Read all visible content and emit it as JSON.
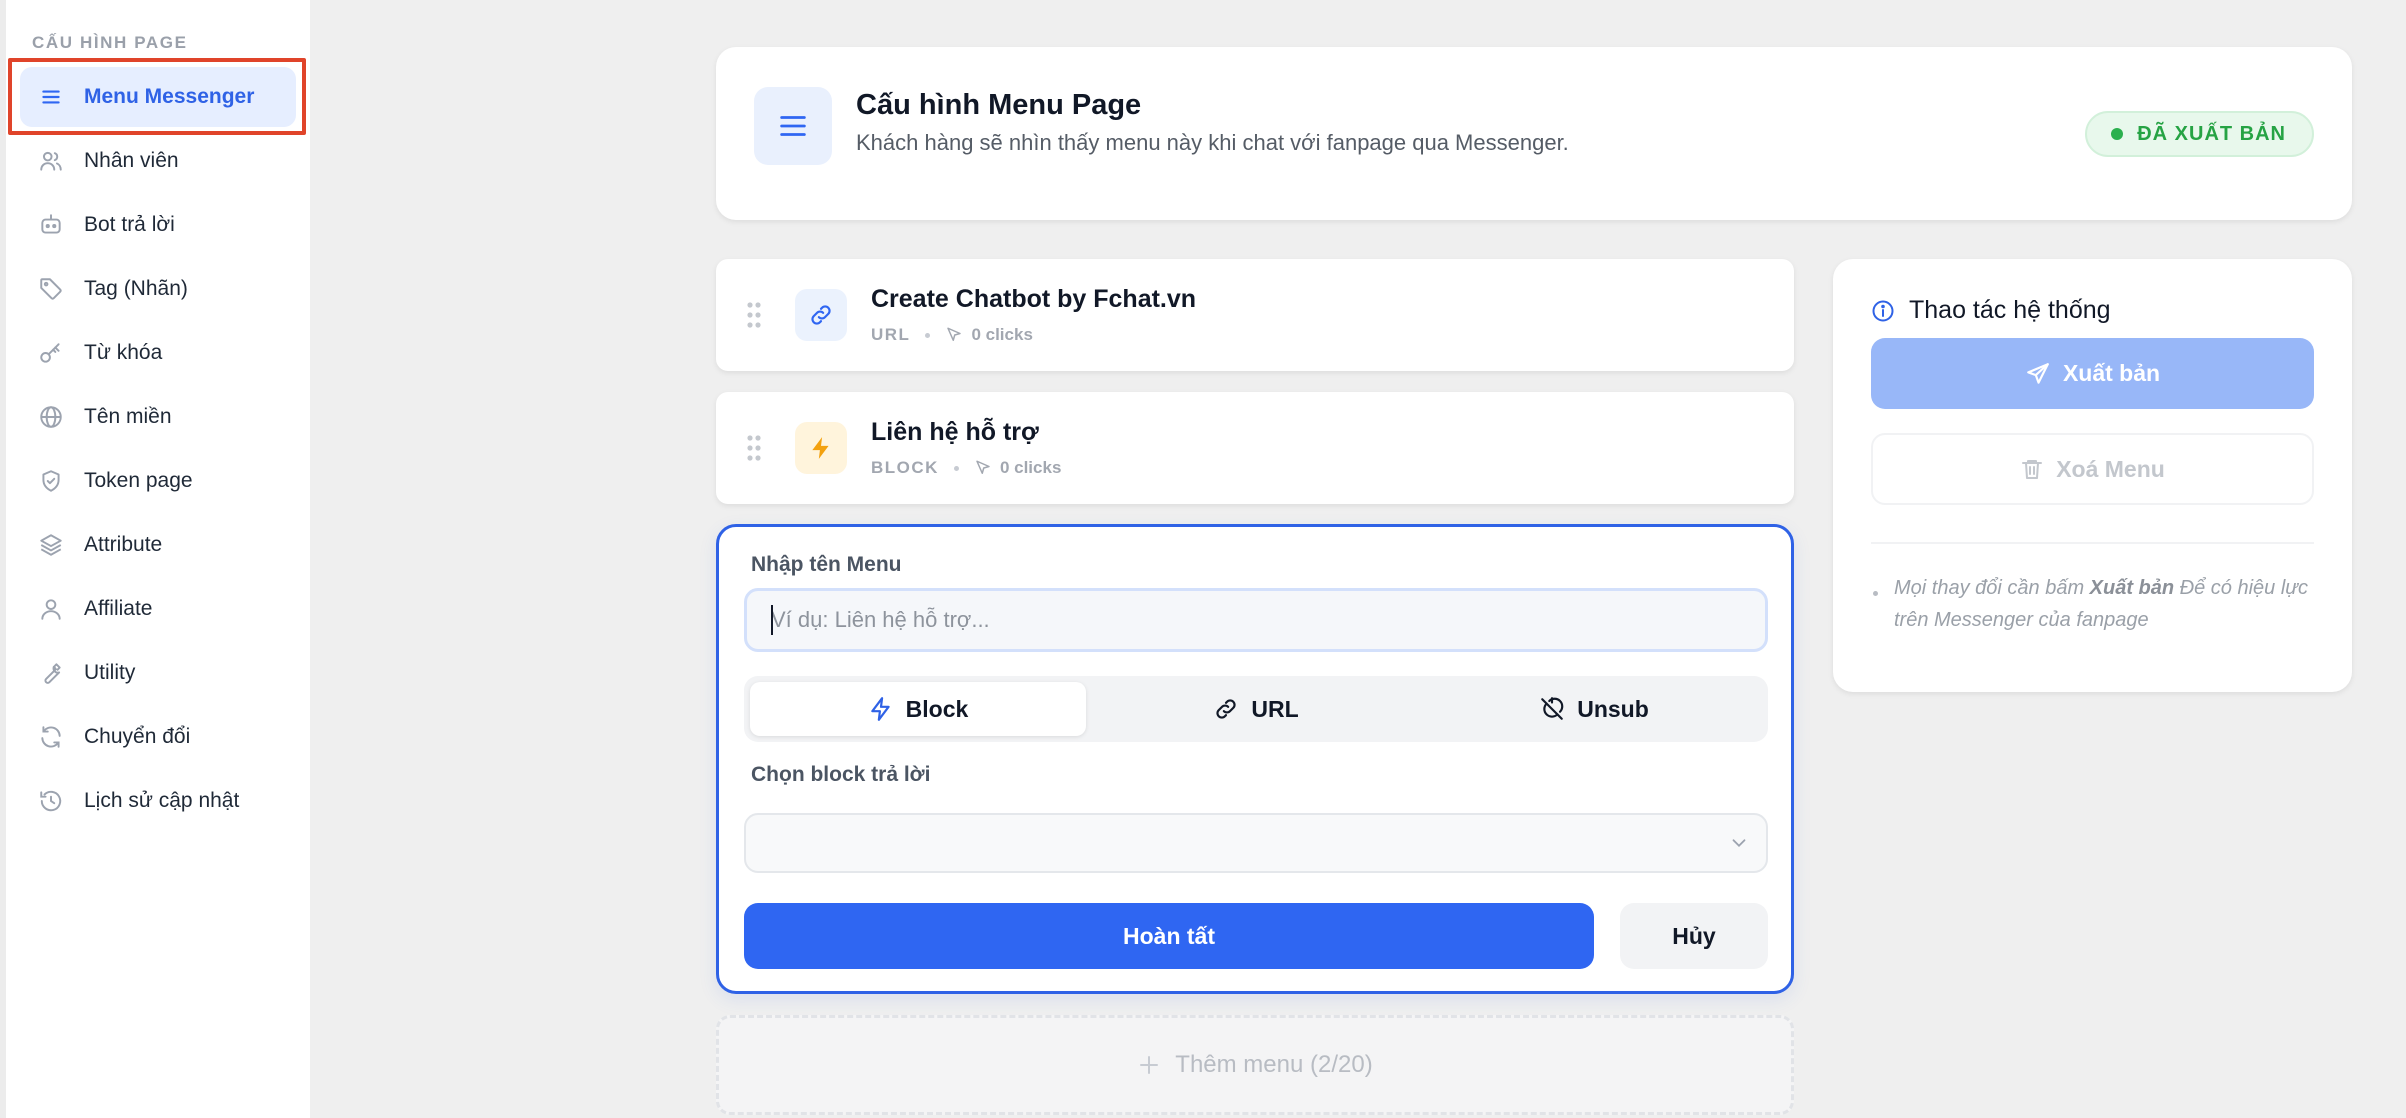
{
  "sidebar": {
    "section_title": "CẤU HÌNH PAGE",
    "items": [
      {
        "label": "Menu Messenger",
        "icon": "menu-icon",
        "active": true
      },
      {
        "label": "Nhân viên",
        "icon": "users-icon"
      },
      {
        "label": "Bot trả lời",
        "icon": "bot-icon"
      },
      {
        "label": "Tag (Nhãn)",
        "icon": "tag-icon"
      },
      {
        "label": "Từ khóa",
        "icon": "key-icon"
      },
      {
        "label": "Tên miền",
        "icon": "globe-icon"
      },
      {
        "label": "Token page",
        "icon": "shield-icon"
      },
      {
        "label": "Attribute",
        "icon": "layers-icon"
      },
      {
        "label": "Affiliate",
        "icon": "user-icon"
      },
      {
        "label": "Utility",
        "icon": "wrench-icon"
      },
      {
        "label": "Chuyển đổi",
        "icon": "refresh-icon"
      },
      {
        "label": "Lịch sử cập nhật",
        "icon": "history-icon"
      }
    ]
  },
  "header": {
    "icon": "menu-icon",
    "title": "Cấu hình Menu Page",
    "subtitle": "Khách hàng sẽ nhìn thấy menu này khi chat với fanpage qua Messenger.",
    "status": "ĐÃ XUẤT BẢN",
    "status_color": "#26a344"
  },
  "menu_items": [
    {
      "title": "Create Chatbot by Fchat.vn",
      "type": "URL",
      "clicks": "0 clicks",
      "icon": "link-icon"
    },
    {
      "title": "Liên hệ hỗ trợ",
      "type": "BLOCK",
      "clicks": "0 clicks",
      "icon": "lightning-icon"
    }
  ],
  "editor": {
    "name_label": "Nhập tên Menu",
    "name_value": "",
    "name_placeholder": "Ví dụ: Liên hệ hỗ trợ...",
    "types": [
      {
        "label": "Block",
        "icon": "lightning-icon",
        "active": true
      },
      {
        "label": "URL",
        "icon": "link-icon"
      },
      {
        "label": "Unsub",
        "icon": "unsubscribe-icon"
      }
    ],
    "block_label": "Chọn block trả lời",
    "block_value": "",
    "submit_label": "Hoàn tất",
    "cancel_label": "Hủy",
    "accent_color": "#2f66f2"
  },
  "add_menu": {
    "label": "Thêm menu (2/20)"
  },
  "side_panel": {
    "title": "Thao tác hệ thống",
    "publish_label": "Xuất bản",
    "delete_label": "Xoá Menu",
    "note_prefix": "Mọi thay đổi cần bấm ",
    "note_bold": "Xuất bản",
    "note_suffix": " Để có hiệu lực trên Messenger của fanpage"
  }
}
